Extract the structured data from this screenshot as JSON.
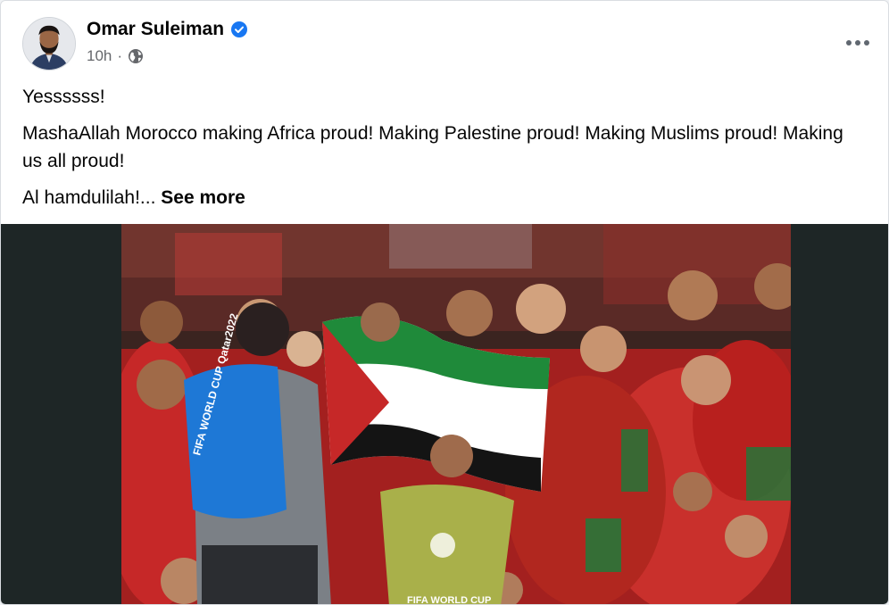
{
  "post": {
    "author": "Omar Suleiman",
    "timestamp": "10h",
    "meta_separator": "·",
    "audience_icon": "globe-icon",
    "verified_icon": "verified-badge-icon",
    "more_icon": "more-options-icon",
    "paragraphs": [
      "Yessssss!",
      "MashaAllah Morocco making Africa proud! Making Palestine proud! Making Muslims proud! Making us all proud!"
    ],
    "last_paragraph_text": "Al hamdulilah!...",
    "see_more_label": "See more",
    "photo": {
      "jersey_text_left": "FIFA WORLD CUP Qatar2022",
      "jersey_text_bottom": "FIFA WORLD CUP"
    }
  },
  "colors": {
    "verified": "#1877f2",
    "secondary_text": "#65676b",
    "media_background": "#1e2626"
  }
}
